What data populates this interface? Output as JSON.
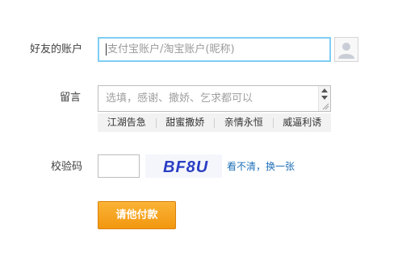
{
  "form": {
    "account": {
      "label": "好友的账户",
      "placeholder": "支付宝账户/淘宝账户(昵称)",
      "avatar_icon": "user-avatar-icon"
    },
    "message": {
      "label": "留言",
      "placeholder": "选填，感谢、撒娇、乞求都可以",
      "quick_phrases": [
        "江湖告急",
        "甜蜜撒娇",
        "亲情永恒",
        "威逼利诱"
      ]
    },
    "captcha": {
      "label": "校验码",
      "image_text": "BF8U",
      "refresh_label": "看不清，换一张"
    },
    "submit_label": "请他付款"
  },
  "colors": {
    "focus_border": "#7ecef4",
    "button": "#f29710",
    "link": "#1d6fb8",
    "captcha_text": "#2b3ec4"
  }
}
